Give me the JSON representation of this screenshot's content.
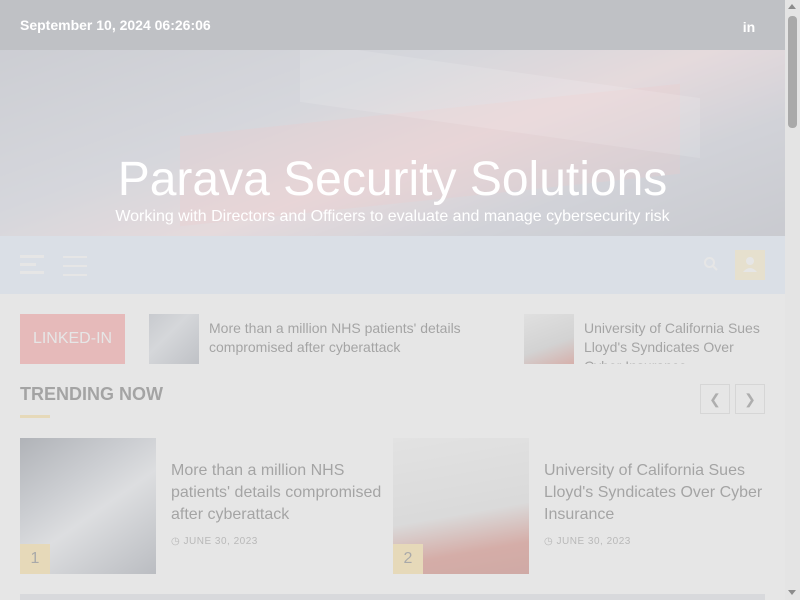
{
  "topbar": {
    "datetime": "September 10, 2024 06:26:06",
    "social_icon": "linkedin-icon",
    "social_label": "in"
  },
  "header": {
    "site_title": "Parava Security Solutions",
    "tagline": "Working with Directors and Officers to evaluate and manage cybersecurity risk"
  },
  "nav": {
    "offcanvas_icon": "offcanvas-menu-icon",
    "menu_icon": "hamburger-icon",
    "search_icon": "search-icon",
    "user_icon": "user-icon"
  },
  "ticker": {
    "label": "LINKED-IN",
    "items": [
      {
        "title": "More than a million NHS patients' details compromised after cyberattack"
      },
      {
        "title": "University of California Sues Lloyd's Syndicates Over Cyber Insurance"
      }
    ]
  },
  "trending": {
    "title": "TRENDING NOW",
    "prev_icon": "chevron-left-icon",
    "next_icon": "chevron-right-icon",
    "cards": [
      {
        "number": "1",
        "title": "More than a million NHS patients' details compromised after cyberattack",
        "date": "JUNE 30, 2023"
      },
      {
        "number": "2",
        "title": "University of California Sues Lloyd's Syndicates Over Cyber Insurance",
        "date": "JUNE 30, 2023"
      }
    ]
  },
  "colors": {
    "accent": "#ffd26a",
    "ticker_label": "#ff6b6b",
    "navbar": "#d8e6ff",
    "topbar": "#1c2230"
  }
}
